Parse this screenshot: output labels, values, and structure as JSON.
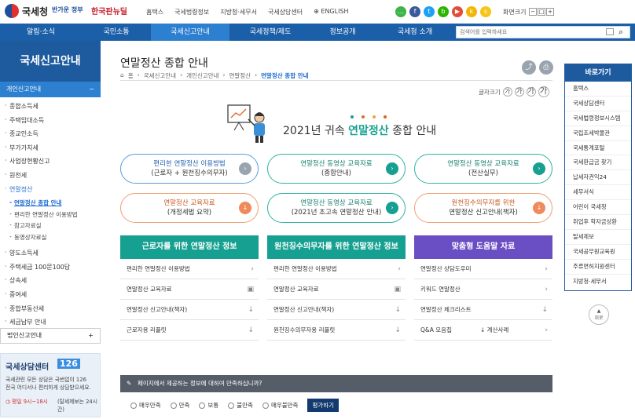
{
  "header": {
    "logo_text": "국세청",
    "logo2": "반가운 정부",
    "logo3": "한국판뉴딜",
    "links": [
      "홈택스",
      "국세법령정보",
      "지방청·세무서",
      "국세상담센터",
      "ENGLISH"
    ],
    "screen_size_label": "화면크기",
    "zoom_minus": "−",
    "zoom_reset": "□",
    "zoom_plus": "+"
  },
  "nav": {
    "items": [
      "알림·소식",
      "국민소통",
      "국세신고안내",
      "국세정책/제도",
      "정보공개",
      "국세청 소개"
    ],
    "search_placeholder": "검색어를 입력하세요"
  },
  "sidebar": {
    "title": "국세신고안내",
    "section": "개인신고안내",
    "section_toggle": "−",
    "items": [
      "종합소득세",
      "주택임대소득",
      "종교인소득",
      "부가가치세",
      "사업장현황신고",
      "원천세",
      "연말정산"
    ],
    "subitems": [
      "연말정산 종합 안내",
      "편리한 연말정산 이용방법",
      "참고자료실",
      "동영상자료실"
    ],
    "items2": [
      "양도소득세",
      "주택세금 100문100답",
      "상속세",
      "증여세",
      "종합부동산세",
      "세금납부 안내"
    ],
    "section2": "법인신고안내",
    "section2_toggle": "+"
  },
  "counsel": {
    "title": "국세상담센터",
    "number": "126",
    "desc1": "국세관련 모든 상담은 국번없이 126",
    "desc2": "전국 어디서나 편리하게 상담받으세요.",
    "hours": "평일 9시~18시",
    "hours_note": "(탈세제보는 24시간)"
  },
  "page": {
    "title": "연말정산 종합 안내",
    "breadcrumb": [
      "홈",
      "국세신고안내",
      "개인신고안내",
      "연말정산",
      "연말정산 종합 안내"
    ],
    "font_size_label": "글자크기",
    "font_sizes": [
      "가",
      "가",
      "가",
      "가"
    ],
    "share_glyph": "⤴",
    "print_glyph": "⎙",
    "banner_prefix": "2021년 귀속 ",
    "banner_highlight": "연말정산",
    "banner_suffix": " 종합 안내"
  },
  "pills": [
    {
      "l1": "편리한 연말정산 이용방법",
      "l2": "(근로자 + 원천징수의무자)"
    },
    {
      "l1": "연말정산 동영상 교육자료",
      "l2": "(종합안내)"
    },
    {
      "l1": "연말정산 동영상 교육자료",
      "l2": "(전산실무)"
    },
    {
      "l1": "연말정산 교육자료",
      "l2": "(개정세법 요약)"
    },
    {
      "l1": "연말정산 동영상 교육자료",
      "l2": "(2021년 초고속 연말정산 안내)"
    },
    {
      "l1": "원천징수의무자를 위한",
      "l2": "연말정산 신고안내(책자)"
    }
  ],
  "columns": [
    {
      "head": "근로자를 위한 연말정산 정보",
      "rows": [
        "편리한 연말정산 이용방법",
        "연말정산 교육자료",
        "연말정산 신고안내(책자)",
        "근로자용 리플릿"
      ]
    },
    {
      "head": "원천징수의무자를 위한 연말정산 정보",
      "rows": [
        "편리한 연말정산 이용방법",
        "연말정산 교육자료",
        "연말정산 신고안내(책자)",
        "원천징수의무자용 리플릿"
      ]
    },
    {
      "head": "맞춤형 도움말 자료",
      "rows": [
        "연말정산 상담도우미",
        "키워드 연말정산",
        "연말정산 체크리스트",
        "Q&A 모음집"
      ],
      "extra": "계산사례"
    }
  ],
  "survey": {
    "question": "페이지에서 제공하는 정보에 대하여 만족하십니까?",
    "options": [
      "매우만족",
      "만족",
      "보통",
      "불만족",
      "매우불만족"
    ],
    "submit": "평가하기"
  },
  "quick": {
    "title": "바로가기",
    "items": [
      "홈택스",
      "국세상담센터",
      "국세법령정보시스템",
      "국립조세박물관",
      "국세통계포털",
      "국세환급금 찾기",
      "납세자권익24",
      "세무서식",
      "어린이 국세청",
      "취업후 학자금상환",
      "탈세제보",
      "국세공무원교육원",
      "주류면허지원센터",
      "지방청·세무서"
    ],
    "top_label": "위로"
  },
  "colors": {
    "nav": "#1b5fa8",
    "teal": "#16a091",
    "purple": "#6a4ec4",
    "accent": "#2d7fd0"
  }
}
